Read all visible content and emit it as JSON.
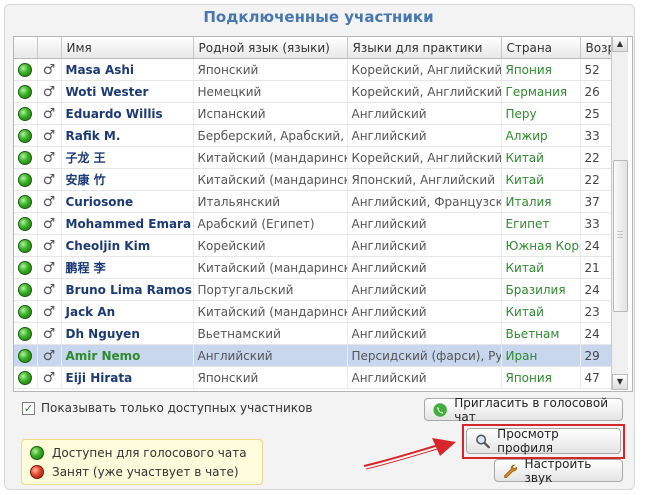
{
  "title": "Подключенные участники",
  "columns": [
    "Имя",
    "Родной язык (языки)",
    "Языки для практики",
    "Страна",
    "Возр"
  ],
  "rows": [
    {
      "name": "Masa Ashi",
      "native": "Японский",
      "practice": "Корейский, Английский",
      "country": "Япония",
      "age": "52"
    },
    {
      "name": "Woti Wester",
      "native": "Немецкий",
      "practice": "Корейский, Английский, Я",
      "country": "Германия",
      "age": "26"
    },
    {
      "name": "Eduardo Willis",
      "native": "Испанский",
      "practice": "Английский",
      "country": "Перу",
      "age": "25"
    },
    {
      "name": "Rafik M.",
      "native": "Берберский, Арабский, Фр",
      "practice": "Английский",
      "country": "Алжир",
      "age": "33"
    },
    {
      "name": "子龙 王",
      "native": "Китайский (мандаринский",
      "practice": "Корейский, Английский",
      "country": "Китай",
      "age": "22"
    },
    {
      "name": "安康 竹",
      "native": "Китайский (мандаринский",
      "practice": "Японский, Английский",
      "country": "Китай",
      "age": "22"
    },
    {
      "name": "Curiosone",
      "native": "Итальянский",
      "practice": "Английский, Французский,",
      "country": "Италия",
      "age": "37"
    },
    {
      "name": "Mohammed Emara",
      "native": "Арабский (Египет)",
      "practice": "Английский",
      "country": "Египет",
      "age": "33"
    },
    {
      "name": "Cheoljin Kim",
      "native": "Корейский",
      "practice": "Английский",
      "country": "Южная Коре",
      "age": "24"
    },
    {
      "name": "鹏程 李",
      "native": "Китайский (мандаринский",
      "practice": "Английский",
      "country": "Китай",
      "age": "21"
    },
    {
      "name": "Bruno Lima Ramos",
      "native": "Португальский",
      "practice": "Английский",
      "country": "Бразилия",
      "age": "24"
    },
    {
      "name": "Jack An",
      "native": "Китайский (мандаринский",
      "practice": "Английский",
      "country": "Китай",
      "age": "23"
    },
    {
      "name": "Dh Nguyen",
      "native": "Вьетнамский",
      "practice": "Английский",
      "country": "Вьетнам",
      "age": "24"
    },
    {
      "name": "Amir Nemo",
      "native": "Английский",
      "practice": "Персидский (фарси), Русс",
      "country": "Иран",
      "age": "29",
      "selected": true
    },
    {
      "name": "Eiji Hirata",
      "native": "Японский",
      "practice": "Английский",
      "country": "Япония",
      "age": "47"
    }
  ],
  "checkbox": {
    "label": "Показывать только доступных участников",
    "checked": true
  },
  "legend": {
    "available": "Доступен для голосового чата",
    "busy": "Занят (уже участвует в чате)"
  },
  "buttons": {
    "invite": "Пригласить в голосовой чат",
    "profile": "Просмотр профиля",
    "sound": "Настроить звук"
  },
  "icons": {
    "status": "green-status-dot",
    "gender": "male-icon"
  },
  "colors": {
    "title": "#4677b0",
    "name": "#1d3a78",
    "country": "#2e8b2e",
    "highlight": "#d7262a"
  }
}
